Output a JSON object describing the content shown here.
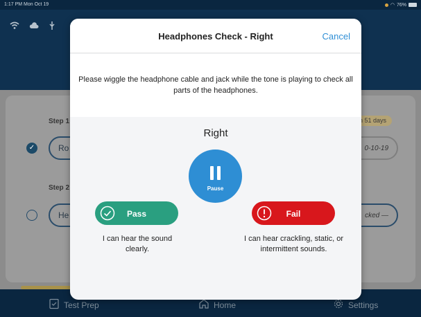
{
  "status_bar": {
    "time": "1:17 PM  Mon Oct 19",
    "battery": "76%"
  },
  "background": {
    "step1_label": "Step 1",
    "step1_button": "Ro",
    "step1_date": "0-10-19",
    "badge": "n 51 days",
    "step2_label": "Step 2",
    "step2_button": "He",
    "step2_status": "cked —",
    "tabs": [
      {
        "label": "Test Prep",
        "icon": "checklist-icon"
      },
      {
        "label": "Home",
        "icon": "home-icon"
      },
      {
        "label": "Settings",
        "icon": "gear-icon"
      }
    ]
  },
  "modal": {
    "title": "Headphones Check - Right",
    "cancel_label": "Cancel",
    "instruction": "Please wiggle the headphone cable and jack while the tone is playing to check all parts of the headphones.",
    "side": "Right",
    "pause_label": "Pause",
    "pass_label": "Pass",
    "pass_description": "I can hear the sound clearly.",
    "fail_label": "Fail",
    "fail_description": "I can hear crackling, static, or intermittent sounds."
  },
  "colors": {
    "accent": "#2e8ed4",
    "pass": "#2a9f80",
    "fail": "#d8171c",
    "navy": "#0f3150"
  }
}
